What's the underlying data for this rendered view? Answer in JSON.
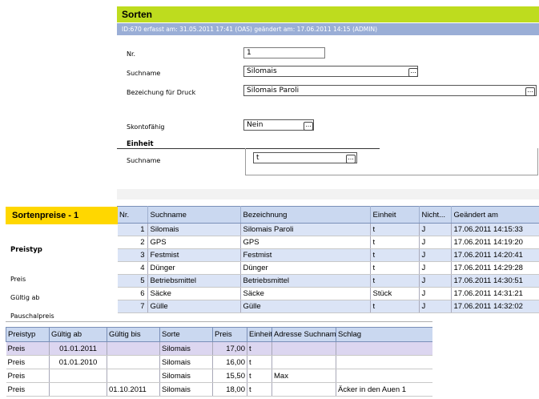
{
  "sorten": {
    "title": "Sorten",
    "info": "ID:670  erfasst am: 31.05.2011 17:41  (OAS)    geändert am: 17.06.2011 14:15  (ADMIN)",
    "fields": {
      "nr_label": "Nr.",
      "nr_value": "1",
      "suchname_label": "Suchname",
      "suchname_value": "Silomais",
      "bezeichnung_label": "Bezeichung für Druck",
      "bezeichnung_value": "Silomais Paroli",
      "skonto_label": "Skontofähig",
      "skonto_value": "Nein"
    },
    "einheit": {
      "title": "Einheit",
      "suchname_label": "Suchname",
      "suchname_value": "t"
    },
    "picker_glyph": "...",
    "grid": {
      "columns": [
        "Nr.",
        "Suchname",
        "Bezeichnung",
        "Einheit",
        "Nicht...",
        "Geändert am"
      ],
      "rows": [
        [
          "1",
          "Silomais",
          "Silomais Paroli",
          "t",
          "J",
          "17.06.2011 14:15:33"
        ],
        [
          "2",
          "GPS",
          "GPS",
          "t",
          "J",
          "17.06.2011 14:19:20"
        ],
        [
          "3",
          "Festmist",
          "Festmist",
          "t",
          "J",
          "17.06.2011 14:20:41"
        ],
        [
          "4",
          "Dünger",
          "Dünger",
          "t",
          "J",
          "17.06.2011 14:29:28"
        ],
        [
          "5",
          "Betriebsmittel",
          "Betriebsmittel",
          "t",
          "J",
          "17.06.2011 14:30:51"
        ],
        [
          "6",
          "Säcke",
          "Säcke",
          "Stück",
          "J",
          "17.06.2011 14:31:21"
        ],
        [
          "7",
          "Gülle",
          "Gülle",
          "t",
          "J",
          "17.06.2011 14:32:02"
        ]
      ]
    }
  },
  "sortenpreise": {
    "title": "Sortenpreise - 1",
    "preistyp_label": "Preistyp",
    "preis_label": "Preis",
    "gueltig_label": "Gültig ab",
    "pauschal_label": "Pauschalpreis",
    "grid": {
      "columns": [
        "Preistyp",
        "Gültig ab",
        "Gültig bis",
        "Sorte",
        "Preis",
        "Einheit",
        "Adresse Suchname",
        "Schlag"
      ],
      "rows": [
        [
          "Preis",
          "01.01.2011",
          "",
          "Silomais",
          "17,00",
          "t",
          "",
          ""
        ],
        [
          "Preis",
          "01.01.2010",
          "",
          "Silomais",
          "16,00",
          "t",
          "",
          ""
        ],
        [
          "Preis",
          "",
          "",
          "Silomais",
          "15,50",
          "t",
          "Max",
          ""
        ],
        [
          "Preis",
          "",
          "01.10.2011",
          "Silomais",
          "18,00",
          "t",
          "",
          "Äcker in den Auen 1"
        ]
      ]
    }
  }
}
